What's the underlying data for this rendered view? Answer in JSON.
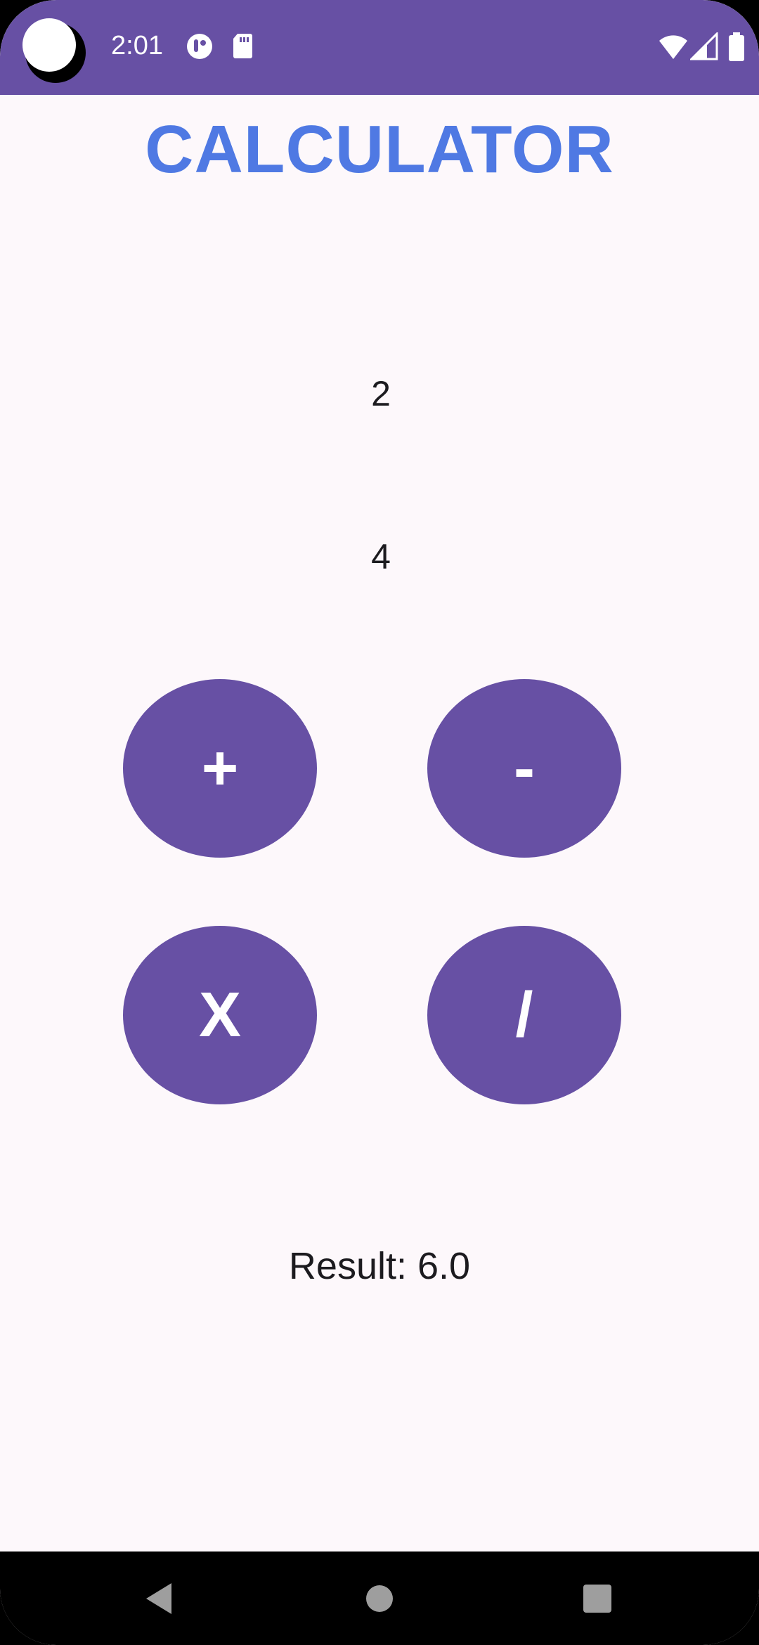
{
  "status_bar": {
    "time": "2:01",
    "icons": [
      "app-notification-icon",
      "sd-card-icon",
      "wifi-icon",
      "signal-icon",
      "battery-icon"
    ]
  },
  "app": {
    "title": "CALCULATOR",
    "input_1": "2",
    "input_2": "4",
    "buttons": {
      "add": "+",
      "subtract": "-",
      "multiply": "X",
      "divide": "/"
    },
    "result": "Result: 6.0"
  },
  "colors": {
    "primary": "#6750a4",
    "title": "#4f79e3",
    "background": "#fdf8fb"
  },
  "nav_bar": {
    "icons": [
      "back-icon",
      "home-icon",
      "recents-icon"
    ]
  }
}
